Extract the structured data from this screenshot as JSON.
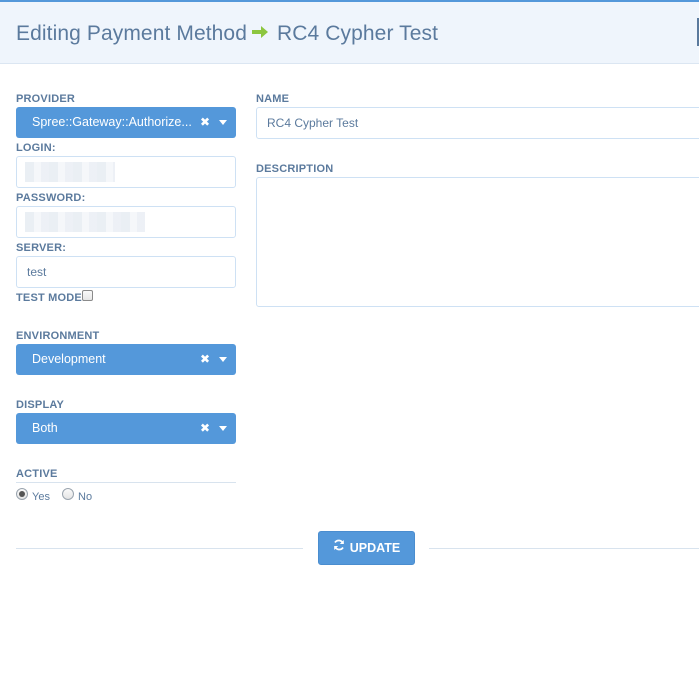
{
  "header": {
    "title": "Editing Payment Method",
    "arrow_icon": "arrow-right-icon",
    "subtitle": "RC4 Cypher Test"
  },
  "form": {
    "provider": {
      "label": "PROVIDER",
      "value": "Spree::Gateway::Authorize..."
    },
    "login": {
      "label": "LOGIN:"
    },
    "password": {
      "label": "PASSWORD:"
    },
    "server": {
      "label": "SERVER:",
      "value": "test"
    },
    "test_mode": {
      "label": "TEST MODE:",
      "checked": false
    },
    "environment": {
      "label": "ENVIRONMENT",
      "value": "Development"
    },
    "display": {
      "label": "DISPLAY",
      "value": "Both"
    },
    "active": {
      "label": "ACTIVE",
      "options": [
        {
          "label": "Yes",
          "checked": true
        },
        {
          "label": "No",
          "checked": false
        }
      ]
    },
    "name": {
      "label": "NAME",
      "value": "RC4 Cypher Test"
    },
    "description": {
      "label": "DESCRIPTION",
      "value": ""
    }
  },
  "actions": {
    "update_label": "UPDATE",
    "update_icon": "refresh-icon"
  },
  "colors": {
    "accent": "#5498da",
    "text": "#5b7a9d",
    "arrow": "#8cc63f",
    "header_bg": "#eff5fc"
  }
}
